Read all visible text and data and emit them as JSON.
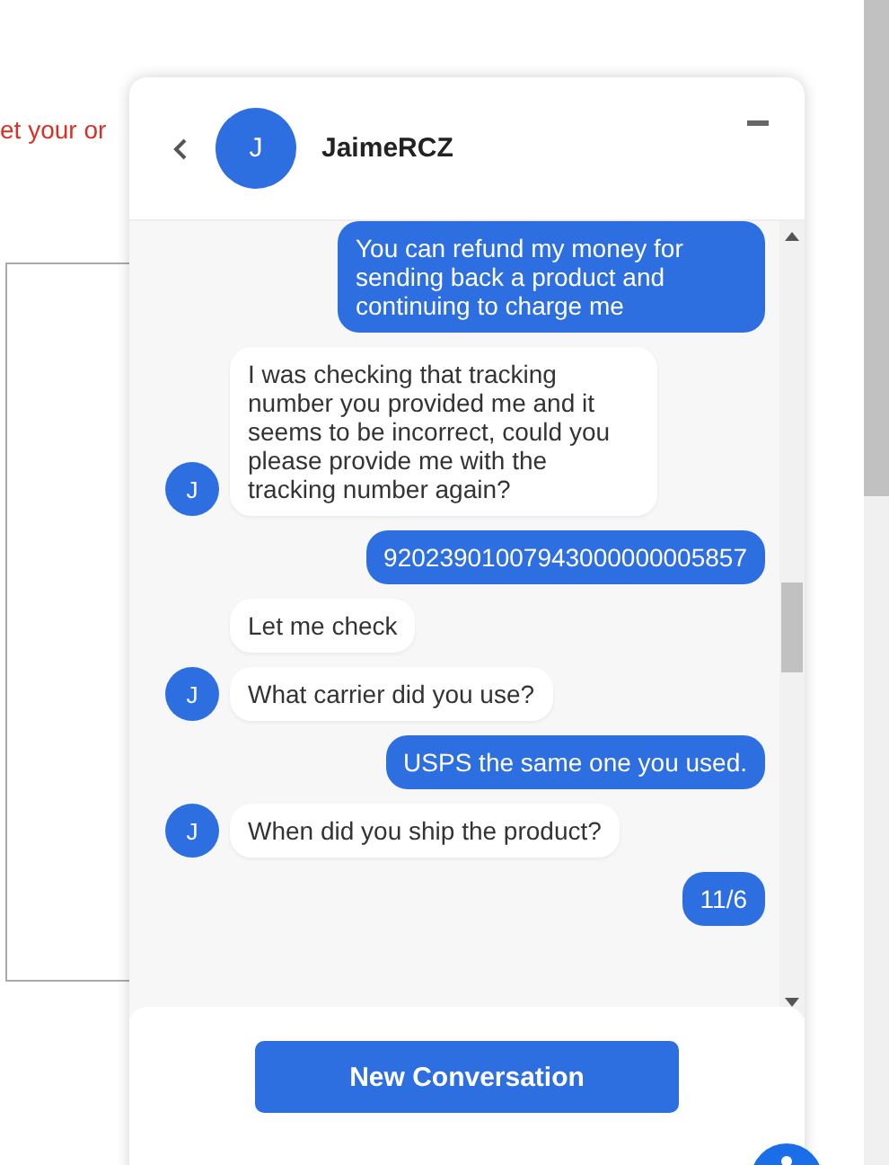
{
  "page": {
    "notice": "et your or"
  },
  "chat": {
    "contact": {
      "name": "JaimeRCZ",
      "initial": "J"
    },
    "messages": [
      {
        "kind": "sent",
        "text": "You can refund my money for sending back a product and continuing to charge me"
      },
      {
        "kind": "received",
        "text": "I was checking that tracking number you provided me and it seems to be incorrect, could you please provide me with the tracking number again?",
        "avatar": "J"
      },
      {
        "kind": "sent",
        "text": "92023901007943000000005857"
      },
      {
        "kind": "received",
        "text": "Let me check"
      },
      {
        "kind": "received",
        "text": "What carrier did you use?",
        "avatar": "J"
      },
      {
        "kind": "sent",
        "text": "USPS the same one you used."
      },
      {
        "kind": "received",
        "text": "When did you ship the product?",
        "avatar": "J"
      },
      {
        "kind": "sent",
        "text": "11/6"
      }
    ],
    "button": "New Conversation"
  }
}
